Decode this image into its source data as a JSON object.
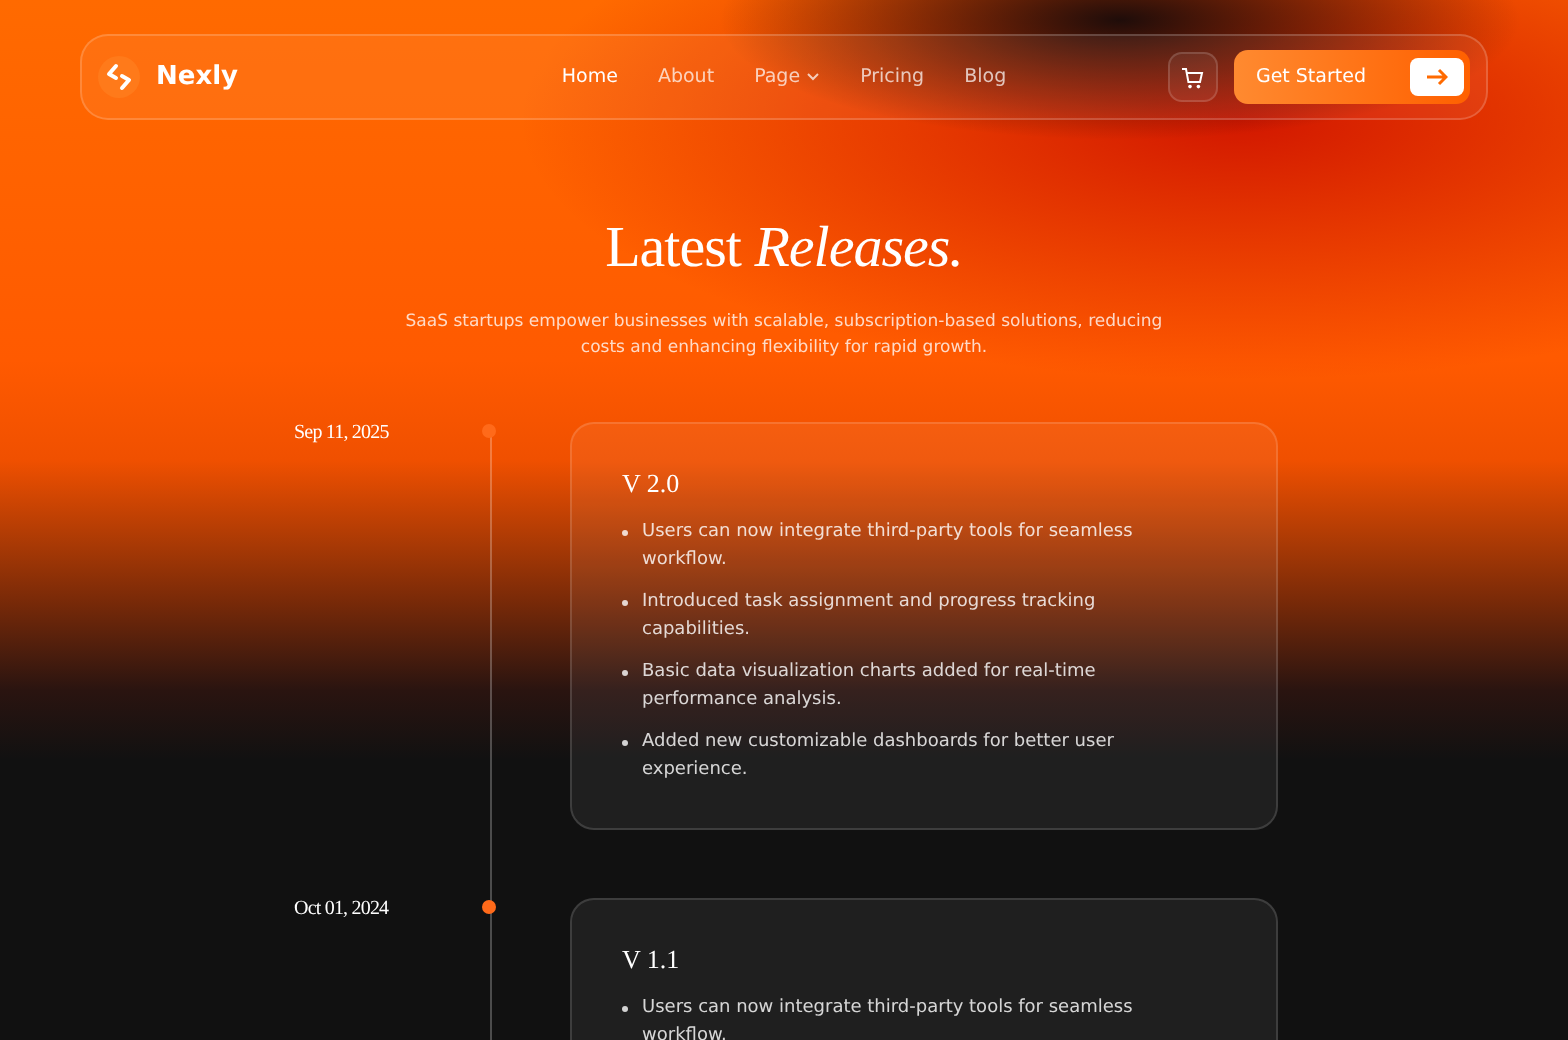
{
  "brand": {
    "name": "Nexly"
  },
  "nav": [
    {
      "label": "Home",
      "selected": true,
      "dropdown": false
    },
    {
      "label": "About",
      "selected": false,
      "dropdown": false
    },
    {
      "label": "Page",
      "selected": false,
      "dropdown": true
    },
    {
      "label": "Pricing",
      "selected": false,
      "dropdown": false
    },
    {
      "label": "Blog",
      "selected": false,
      "dropdown": false
    }
  ],
  "cta": {
    "label": "Get Started"
  },
  "hero": {
    "title": "Latest *Releases.*",
    "subtitle": "SaaS startups empower businesses with scalable, subscription-based solutions, reducing costs and enhancing flexibility for rapid growth."
  },
  "releases": [
    {
      "date": "Sep 11, 2025",
      "version": "V 2.0",
      "notes": [
        "Users can now integrate third-party tools for seamless workflow.",
        "Introduced task assignment and progress tracking capabilities.",
        "Basic data visualization charts added for real-time performance analysis.",
        "Added new customizable dashboards for better user experience."
      ]
    },
    {
      "date": "Oct 01, 2024",
      "version": "V 1.1",
      "notes": [
        "Users can now integrate third-party tools for seamless workflow."
      ]
    }
  ]
}
